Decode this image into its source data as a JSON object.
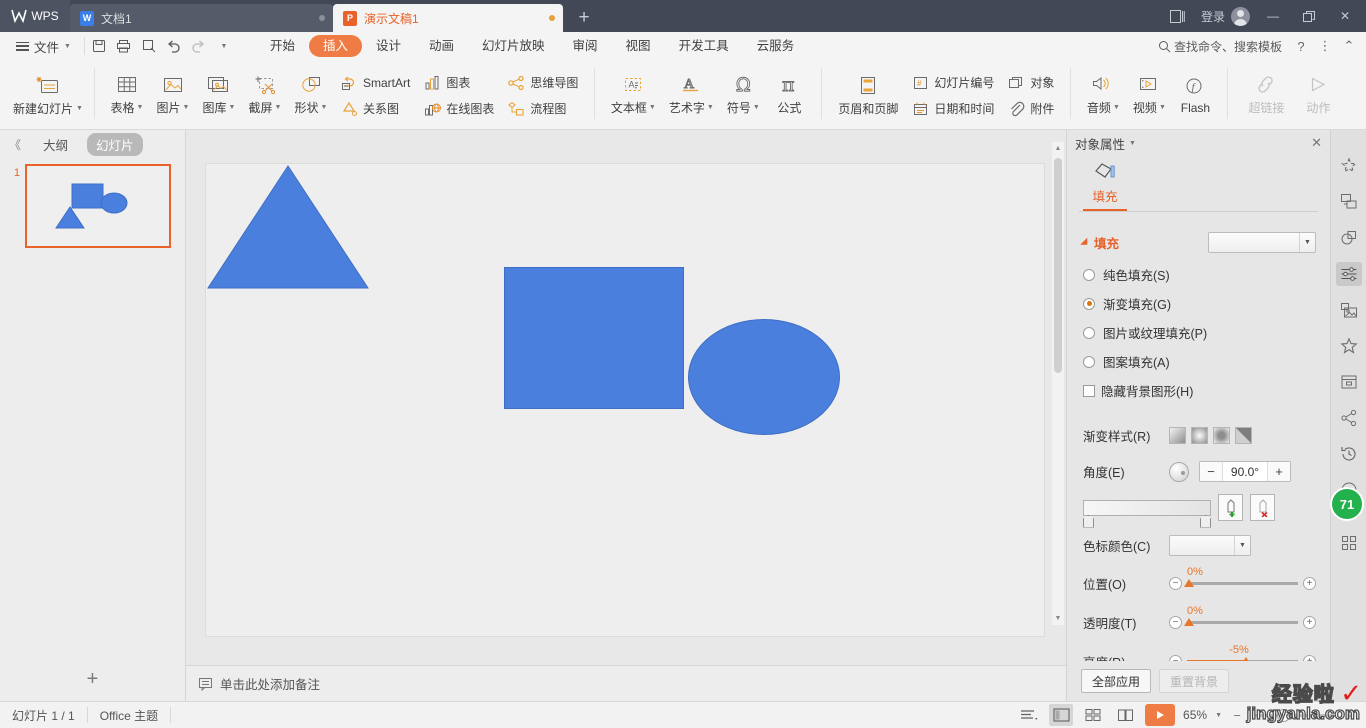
{
  "titlebar": {
    "logo": "WPS",
    "tabs": [
      {
        "label": "文档1",
        "icon": "word-doc-icon",
        "active": false
      },
      {
        "label": "演示文稿1",
        "icon": "presentation-icon",
        "active": true
      }
    ],
    "new_tab": "+",
    "login_label": "登录",
    "minimize": "—",
    "restore": "❐",
    "close": "✕"
  },
  "menubar": {
    "file_label": "文件",
    "quick": [
      "save-icon",
      "print-icon",
      "print-preview-icon",
      "undo-icon",
      "redo-icon",
      "customize-icon"
    ],
    "tabs": [
      {
        "label": "开始",
        "selected": false
      },
      {
        "label": "插入",
        "selected": true
      },
      {
        "label": "设计",
        "selected": false
      },
      {
        "label": "动画",
        "selected": false
      },
      {
        "label": "幻灯片放映",
        "selected": false
      },
      {
        "label": "审阅",
        "selected": false
      },
      {
        "label": "视图",
        "selected": false
      },
      {
        "label": "开发工具",
        "selected": false
      },
      {
        "label": "云服务",
        "selected": false
      }
    ],
    "search_placeholder": "查找命令、搜索模板",
    "help": "?",
    "more": "⋮",
    "collapse": "⌃"
  },
  "ribbon": {
    "new_slide": "新建幻灯片",
    "group2": [
      {
        "label": "表格",
        "icon": "table-icon",
        "dropdown": true
      },
      {
        "label": "图片",
        "icon": "picture-icon",
        "dropdown": true
      },
      {
        "label": "图库",
        "icon": "gallery-icon",
        "dropdown": true
      },
      {
        "label": "截屏",
        "icon": "screenshot-icon",
        "dropdown": true
      },
      {
        "label": "形状",
        "icon": "shapes-icon",
        "dropdown": true
      }
    ],
    "stack1": [
      {
        "label": "SmartArt",
        "icon": "smartart-icon"
      },
      {
        "label": "关系图",
        "icon": "relation-diagram-icon"
      }
    ],
    "stack2": [
      {
        "label": "图表",
        "icon": "chart-icon"
      },
      {
        "label": "在线图表",
        "icon": "online-chart-icon"
      }
    ],
    "stack3": [
      {
        "label": "思维导图",
        "icon": "mindmap-icon"
      },
      {
        "label": "流程图",
        "icon": "flowchart-icon"
      }
    ],
    "group3": [
      {
        "label": "文本框",
        "icon": "textbox-icon",
        "dropdown": true
      },
      {
        "label": "艺术字",
        "icon": "wordart-icon",
        "dropdown": true
      },
      {
        "label": "符号",
        "icon": "symbol-icon",
        "dropdown": true
      },
      {
        "label": "公式",
        "icon": "formula-icon",
        "dropdown": false
      }
    ],
    "header_footer": "页眉和页脚",
    "stack4": [
      {
        "label": "幻灯片编号",
        "icon": "slide-number-icon"
      },
      {
        "label": "日期和时间",
        "icon": "date-time-icon"
      }
    ],
    "stack5": [
      {
        "label": "对象",
        "icon": "object-icon"
      },
      {
        "label": "附件",
        "icon": "attachment-icon"
      }
    ],
    "media": [
      {
        "label": "音频",
        "icon": "audio-icon",
        "dropdown": true
      },
      {
        "label": "视频",
        "icon": "video-icon",
        "dropdown": true
      },
      {
        "label": "Flash",
        "icon": "flash-icon",
        "dropdown": false
      }
    ],
    "links": [
      {
        "label": "超链接",
        "icon": "hyperlink-icon",
        "disabled": true
      },
      {
        "label": "动作",
        "icon": "action-icon",
        "disabled": true
      }
    ]
  },
  "leftpane": {
    "collapse": "《",
    "tab_outline": "大纲",
    "tab_slides": "幻灯片",
    "slide_number": "1",
    "add_slide": "+"
  },
  "slide": {
    "shape_color": "#4a7fdd",
    "shape_border": "#3f6fc5",
    "background": "#eeeeee",
    "shapes": [
      "rectangle",
      "ellipse",
      "triangle"
    ]
  },
  "notes": {
    "placeholder": "单击此处添加备注",
    "icon": "notes-icon"
  },
  "properties": {
    "title": "对象属性",
    "close": "✕",
    "tab_label": "填充",
    "tab_icon": "fill-shape-icon",
    "section_title": "填充",
    "fill_options": [
      {
        "label": "纯色填充(S)",
        "selected": false
      },
      {
        "label": "渐变填充(G)",
        "selected": true
      },
      {
        "label": "图片或纹理填充(P)",
        "selected": false
      },
      {
        "label": "图案填充(A)",
        "selected": false
      }
    ],
    "hide_bg_graphics": {
      "label": "隐藏背景图形(H)",
      "checked": false
    },
    "gradient_style_label": "渐变样式(R)",
    "gradient_styles": [
      "linear",
      "radial-center",
      "radial-edge",
      "diagonal"
    ],
    "angle_label": "角度(E)",
    "angle_value": "90.0°",
    "minus": "−",
    "plus": "+",
    "add_stop_icon": "add-gradient-stop-icon",
    "remove_stop_icon": "remove-gradient-stop-icon",
    "stop_color_label": "色标颜色(C)",
    "position_label": "位置(O)",
    "position_value": "0%",
    "transparency_label": "透明度(T)",
    "transparency_value": "0%",
    "brightness_label": "亮度(R)",
    "brightness_value": "-5%",
    "apply_all": "全部应用",
    "reset_bg": "重置背景"
  },
  "rail": {
    "items": [
      {
        "name": "effects-icon",
        "selected": false
      },
      {
        "name": "copy-shape-icon",
        "selected": false
      },
      {
        "name": "combine-shape-icon",
        "selected": false
      },
      {
        "name": "object-properties-icon",
        "selected": true
      },
      {
        "name": "picture-layout-icon",
        "selected": false
      },
      {
        "name": "favorites-icon",
        "selected": false
      },
      {
        "name": "archive-icon",
        "selected": false
      },
      {
        "name": "share-icon",
        "selected": false
      },
      {
        "name": "history-icon",
        "selected": false
      },
      {
        "name": "help-circle-icon",
        "selected": false
      },
      {
        "name": "apps-grid-icon",
        "selected": false
      }
    ],
    "badge": "71"
  },
  "statusbar": {
    "slide_count": "幻灯片 1 / 1",
    "theme": "Office 主题",
    "views": [
      {
        "name": "outline-view-icon",
        "selected": false
      },
      {
        "name": "normal-view-icon",
        "selected": true
      },
      {
        "name": "slide-sorter-icon",
        "selected": false
      },
      {
        "name": "reading-view-icon",
        "selected": false
      }
    ],
    "play": "▶",
    "zoom": "65%",
    "zoom_out": "−",
    "zoom_in": "+"
  },
  "watermark": {
    "line1": "经验啦",
    "line2": "jingyanla.com",
    "check": "✓"
  }
}
